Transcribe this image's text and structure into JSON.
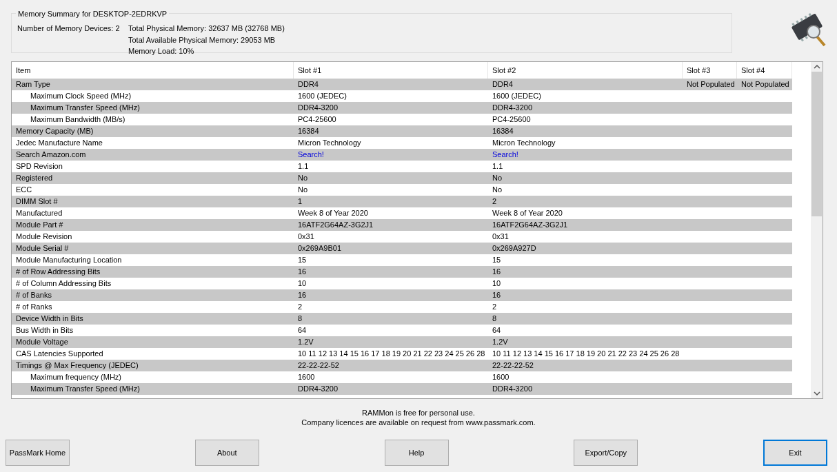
{
  "summary": {
    "title": "Memory Summary for DESKTOP-2EDRKVP",
    "devices": "Number of Memory Devices: 2",
    "lines": [
      "Total Physical Memory: 32637 MB (32768 MB)",
      "Total Available Physical Memory: 29053 MB",
      "Memory Load: 10%"
    ]
  },
  "table": {
    "columns": [
      "Item",
      "Slot #1",
      "Slot #2",
      "Slot #3",
      "Slot #4"
    ],
    "rows": [
      {
        "item": "Ram Type",
        "kind": "text",
        "values": [
          "DDR4",
          "DDR4",
          "Not Populated",
          "Not Populated"
        ],
        "children": [
          {
            "item": "Maximum Clock Speed (MHz)",
            "kind": "text",
            "values": [
              "1600 (JEDEC)",
              "1600 (JEDEC)"
            ]
          },
          {
            "item": "Maximum Transfer Speed (MHz)",
            "kind": "text",
            "values": [
              "DDR4-3200",
              "DDR4-3200"
            ]
          },
          {
            "item": "Maximum Bandwidth (MB/s)",
            "kind": "text",
            "values": [
              "PC4-25600",
              "PC4-25600"
            ]
          }
        ]
      },
      {
        "item": "Memory Capacity (MB)",
        "kind": "text",
        "values": [
          "16384",
          "16384"
        ]
      },
      {
        "item": "Jedec Manufacture Name",
        "kind": "text",
        "values": [
          "Micron Technology",
          "Micron Technology"
        ]
      },
      {
        "item": "Search Amazon.com",
        "kind": "link",
        "values": [
          "Search!",
          "Search!"
        ]
      },
      {
        "item": "SPD Revision",
        "kind": "text",
        "values": [
          "1.1",
          "1.1"
        ]
      },
      {
        "item": "Registered",
        "kind": "text",
        "values": [
          "No",
          "No"
        ]
      },
      {
        "item": "ECC",
        "kind": "text",
        "values": [
          "No",
          "No"
        ]
      },
      {
        "item": "DIMM Slot #",
        "kind": "text",
        "values": [
          "1",
          "2"
        ]
      },
      {
        "item": "Manufactured",
        "kind": "text",
        "values": [
          "Week 8 of Year 2020",
          "Week 8 of Year 2020"
        ]
      },
      {
        "item": "Module Part #",
        "kind": "text",
        "values": [
          "16ATF2G64AZ-3G2J1",
          "16ATF2G64AZ-3G2J1"
        ]
      },
      {
        "item": "Module Revision",
        "kind": "text",
        "values": [
          "0x31",
          "0x31"
        ]
      },
      {
        "item": "Module Serial #",
        "kind": "text",
        "values": [
          "0x269A9B01",
          "0x269A927D"
        ]
      },
      {
        "item": "Module Manufacturing Location",
        "kind": "text",
        "values": [
          "15",
          "15"
        ]
      },
      {
        "item": "# of Row Addressing Bits",
        "kind": "text",
        "values": [
          "16",
          "16"
        ]
      },
      {
        "item": "# of Column Addressing Bits",
        "kind": "text",
        "values": [
          "10",
          "10"
        ]
      },
      {
        "item": "# of Banks",
        "kind": "text",
        "values": [
          "16",
          "16"
        ]
      },
      {
        "item": "# of Ranks",
        "kind": "text",
        "values": [
          "2",
          "2"
        ]
      },
      {
        "item": "Device Width in Bits",
        "kind": "text",
        "values": [
          "8",
          "8"
        ]
      },
      {
        "item": "Bus Width in Bits",
        "kind": "text",
        "values": [
          "64",
          "64"
        ]
      },
      {
        "item": "Module Voltage",
        "kind": "text",
        "values": [
          "1.2V",
          "1.2V"
        ]
      },
      {
        "item": "CAS Latencies Supported",
        "kind": "text",
        "values": [
          "10 11 12 13 14 15 16 17 18 19 20 21 22 23 24 25 26 28",
          "10 11 12 13 14 15 16 17 18 19 20 21 22 23 24 25 26 28"
        ]
      },
      {
        "item": "Timings @ Max Frequency (JEDEC)",
        "kind": "text",
        "values": [
          "22-22-22-52",
          "22-22-22-52"
        ],
        "children": [
          {
            "item": "Maximum frequency (MHz)",
            "kind": "text",
            "values": [
              "1600",
              "1600"
            ]
          },
          {
            "item": "Maximum Transfer Speed (MHz)",
            "kind": "text",
            "values": [
              "DDR4-3200",
              "DDR4-3200"
            ]
          }
        ]
      }
    ]
  },
  "notice": [
    "RAMMon is free for personal use.",
    "Company licences are available on request from www.passmark.com."
  ],
  "buttons": [
    {
      "label": "PassMark Home",
      "focused": false
    },
    {
      "label": "About",
      "focused": false
    },
    {
      "label": "Help",
      "focused": false
    },
    {
      "label": "Export/Copy",
      "focused": false
    },
    {
      "label": "Exit",
      "focused": true
    }
  ]
}
